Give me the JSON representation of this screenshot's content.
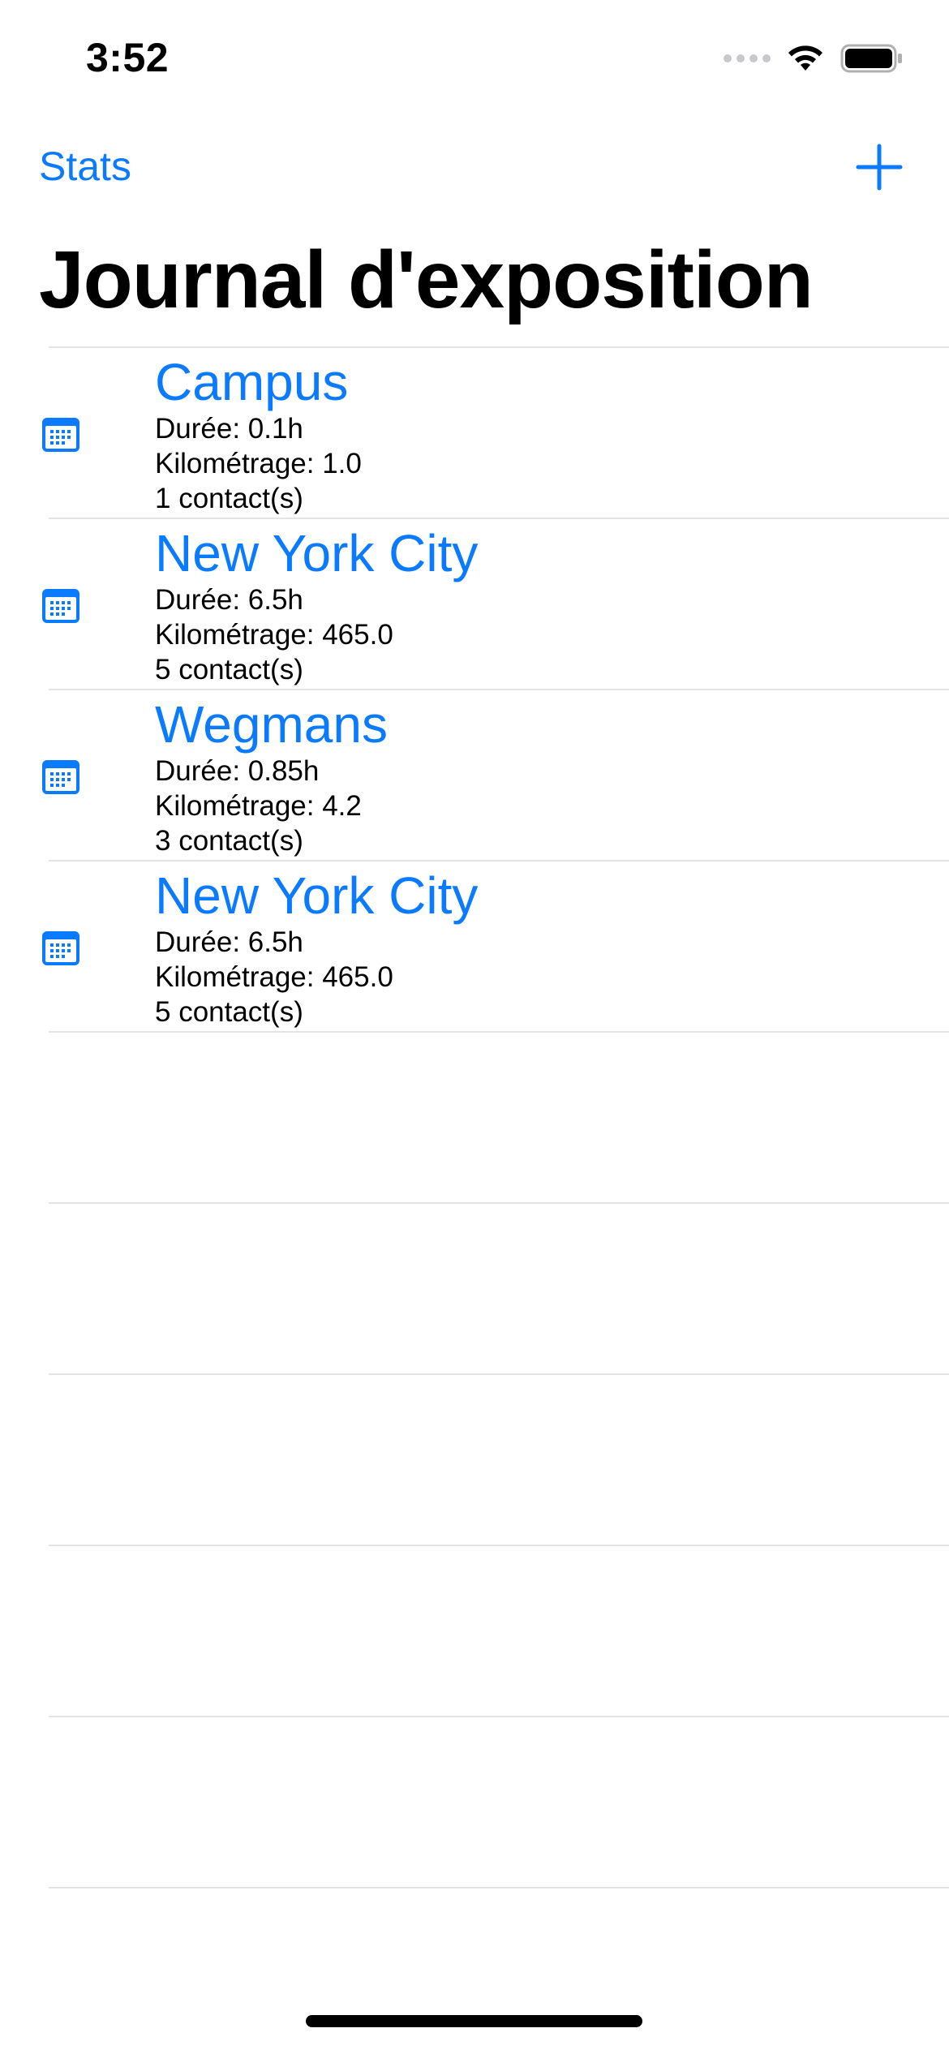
{
  "status_bar": {
    "time": "3:52"
  },
  "nav": {
    "left_label": "Stats",
    "add_icon": "plus-icon",
    "title": "Journal d'exposition"
  },
  "colors": {
    "accent": "#0a7aff",
    "separator": "#e3e3e8"
  },
  "entries": [
    {
      "icon": "calendar-icon",
      "title": "Campus",
      "duration": "Durée: 0.1h",
      "mileage": "Kilométrage: 1.0",
      "contacts": "1 contact(s)"
    },
    {
      "icon": "calendar-icon",
      "title": "New York City",
      "duration": "Durée: 6.5h",
      "mileage": "Kilométrage: 465.0",
      "contacts": "5 contact(s)"
    },
    {
      "icon": "calendar-icon",
      "title": "Wegmans",
      "duration": "Durée: 0.85h",
      "mileage": "Kilométrage: 4.2",
      "contacts": "3 contact(s)"
    },
    {
      "icon": "calendar-icon",
      "title": "New York City",
      "duration": "Durée: 6.5h",
      "mileage": "Kilométrage: 465.0",
      "contacts": "5 contact(s)"
    }
  ]
}
